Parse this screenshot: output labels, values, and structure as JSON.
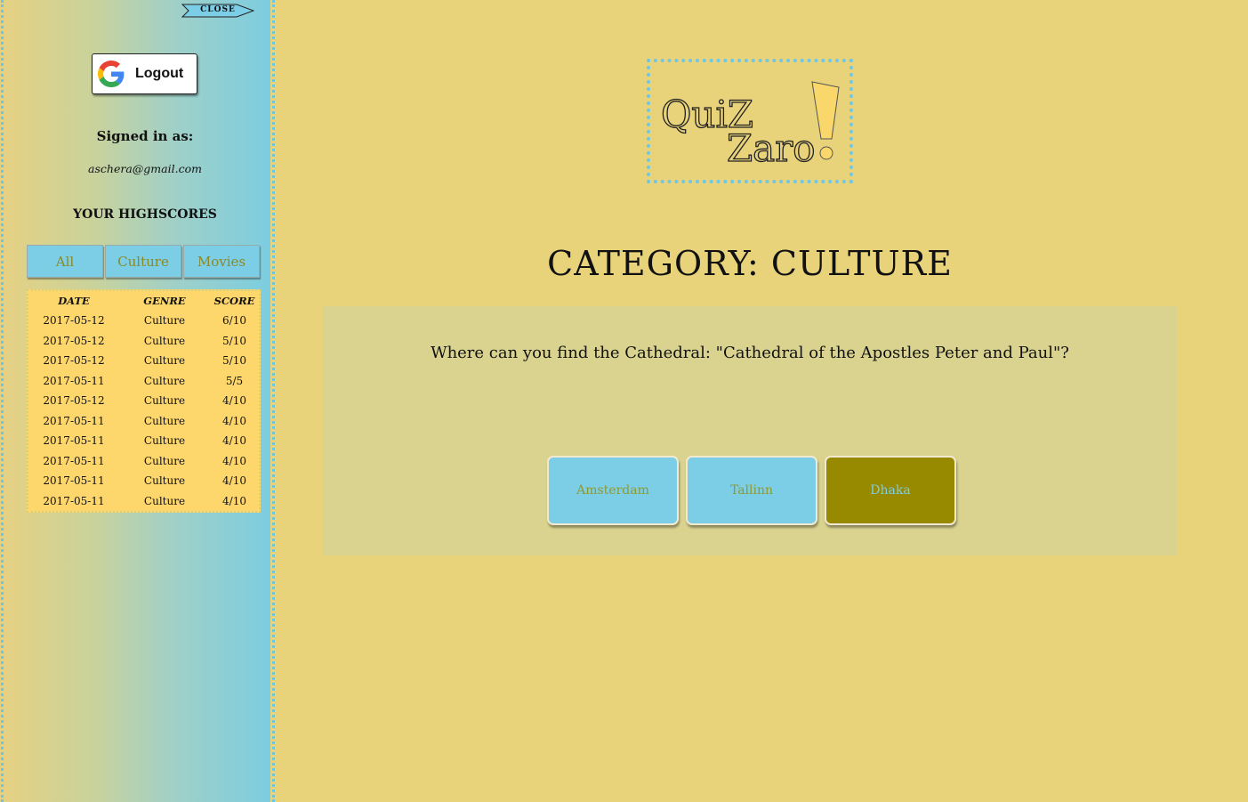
{
  "sidebar": {
    "close_label": "CLOSE",
    "logout_label": "Logout",
    "signed_in_label": "Signed in as:",
    "email": "aschera@gmail.com",
    "highscores_title": "YOUR HIGHSCORES",
    "filters": [
      "All",
      "Culture",
      "Movies"
    ],
    "table": {
      "headers": [
        "DATE",
        "GENRE",
        "SCORE"
      ],
      "rows": [
        [
          "2017-05-12",
          "Culture",
          "6/10"
        ],
        [
          "2017-05-12",
          "Culture",
          "5/10"
        ],
        [
          "2017-05-12",
          "Culture",
          "5/10"
        ],
        [
          "2017-05-11",
          "Culture",
          "5/5"
        ],
        [
          "2017-05-12",
          "Culture",
          "4/10"
        ],
        [
          "2017-05-11",
          "Culture",
          "4/10"
        ],
        [
          "2017-05-11",
          "Culture",
          "4/10"
        ],
        [
          "2017-05-11",
          "Culture",
          "4/10"
        ],
        [
          "2017-05-11",
          "Culture",
          "4/10"
        ],
        [
          "2017-05-11",
          "Culture",
          "4/10"
        ]
      ]
    }
  },
  "logo": {
    "line1": "QuiZ",
    "line2": "Zaro",
    "mark": "!"
  },
  "main": {
    "category_title": "CATEGORY: CULTURE",
    "question": "Where can you find the Cathedral: \"Cathedral of the Apostles Peter and Paul\"?",
    "answers": [
      {
        "label": "Amsterdam",
        "selected": false
      },
      {
        "label": "Tallinn",
        "selected": false
      },
      {
        "label": "Dhaka",
        "selected": true
      }
    ]
  },
  "colors": {
    "background": "#e8d27a",
    "accent_blue": "#7ccde6",
    "selected_answer": "#978a00",
    "score_table_bg": "#fdd66c"
  },
  "icons": [
    "close-arrow-icon",
    "google-g-icon"
  ]
}
